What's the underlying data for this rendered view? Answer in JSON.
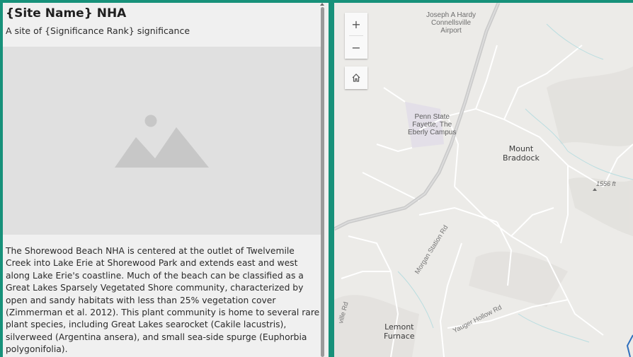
{
  "panel": {
    "title": "{Site Name} NHA",
    "subtitle": "A site of {Significance Rank}  significance",
    "description": " The Shorewood Beach NHA is centered at the outlet of Twelvemile Creek into Lake Erie at Shorewood Park and extends east and west along Lake Erie's coastline. Much of the beach can be classified as a Great Lakes Sparsely Vegetated Shore community, characterized by open and sandy habitats with less than 25% vegetation cover (Zimmerman et al. 2012). This plant community is home to several rare plant species, including Great Lakes searocket (Cakile lacustris), silverweed (Argentina ansera), and small sea-side spurge (Euphorbia polygonifolia)."
  },
  "map": {
    "zoom_in": "+",
    "zoom_out": "−",
    "labels": {
      "airport": "Joseph A Hardy\nConnellsville\nAirport",
      "campus": "Penn State\nFayette, The\nEberly Campus",
      "mount_braddock": "Mount\nBraddock",
      "elevation": "1556 ft",
      "lemont_furnace": "Lemont\nFurnace",
      "morgan_station_rd": "Morgan Station Rd",
      "yauger_hollow_rd": "Yauger Hollow Rd",
      "ville_rd": "ville Rd"
    }
  },
  "colors": {
    "frame": "#17917a",
    "panel_bg": "#f0f0f0",
    "map_bg": "#ecebe8"
  }
}
